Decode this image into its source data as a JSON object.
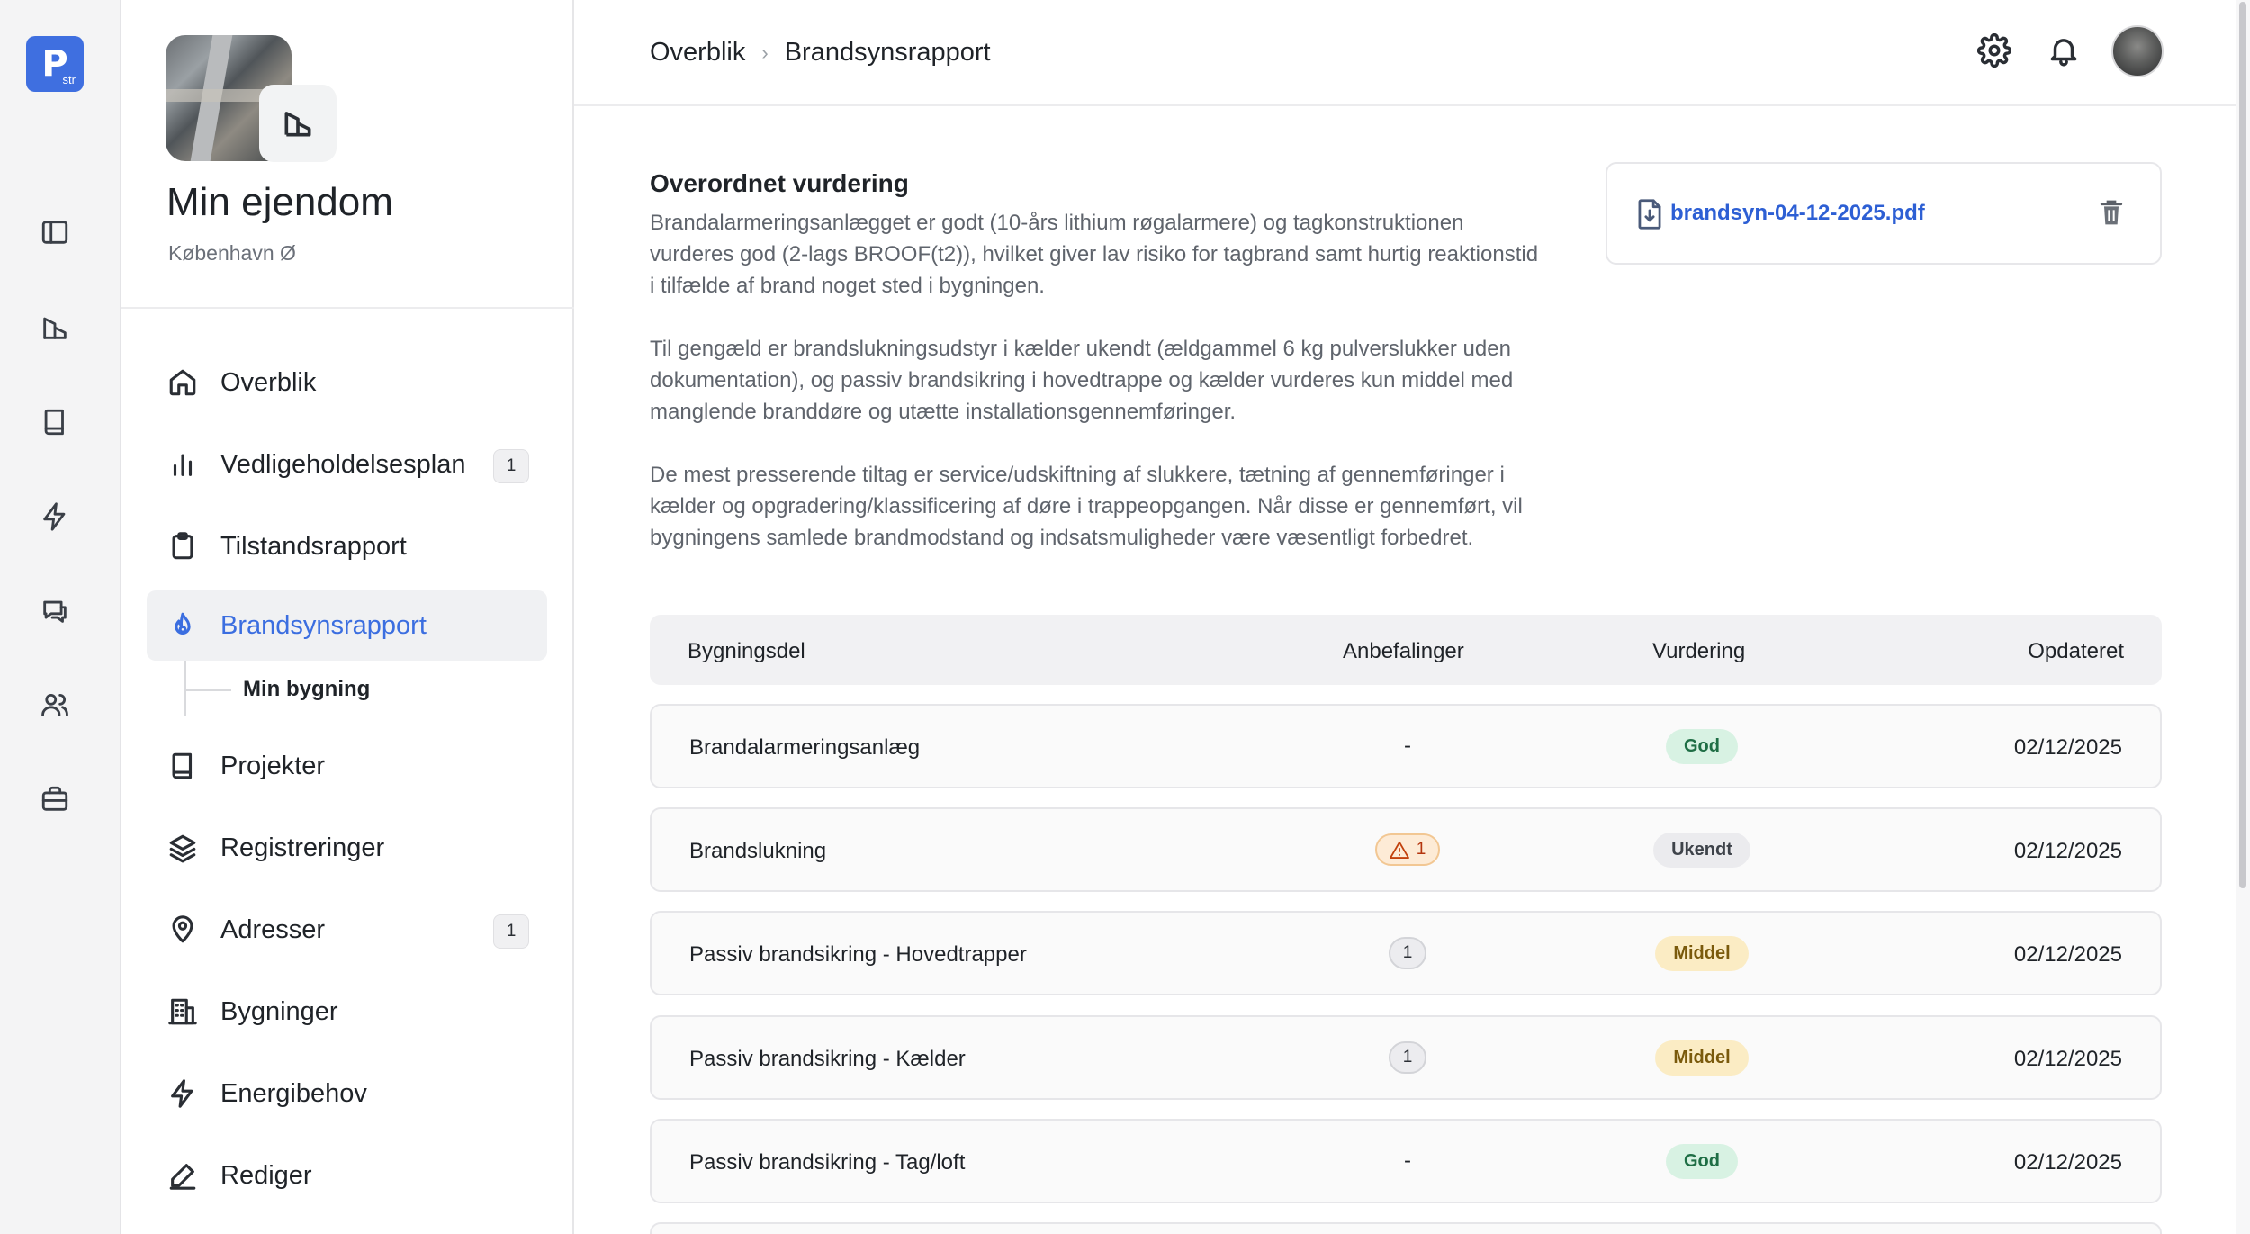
{
  "rail": {
    "logo_text": "P",
    "logo_sub": "str",
    "icons": [
      "sidebar-toggle-icon",
      "building-icon",
      "book-icon",
      "lightning-icon",
      "chat-icon",
      "users-icon",
      "briefcase-icon"
    ]
  },
  "property": {
    "title": "Min ejendom",
    "location": "København Ø"
  },
  "nav": {
    "items": [
      {
        "label": "Overblik",
        "icon": "home-icon"
      },
      {
        "label": "Vedligeholdelsesplan",
        "icon": "bar-chart-icon",
        "count": "1"
      },
      {
        "label": "Tilstandsrapport",
        "icon": "clipboard-icon"
      },
      {
        "label": "Brandsynsrapport",
        "icon": "flame-icon",
        "active": true
      },
      {
        "label": "Projekter",
        "icon": "book-icon"
      },
      {
        "label": "Registreringer",
        "icon": "layers-icon"
      },
      {
        "label": "Adresser",
        "icon": "map-pin-icon",
        "count": "1"
      },
      {
        "label": "Bygninger",
        "icon": "office-building-icon"
      },
      {
        "label": "Energibehov",
        "icon": "lightning-icon"
      },
      {
        "label": "Rediger",
        "icon": "pen-icon"
      }
    ],
    "sub_item": "Min bygning"
  },
  "breadcrumb": {
    "root": "Overblik",
    "separator": "›",
    "current": "Brandsynsrapport"
  },
  "assessment": {
    "title": "Overordnet vurdering",
    "paragraphs": [
      [
        "Brandalarmeringsanlægget er godt (10-års lithium røgalarmere) og tagkonstruktionen",
        "vurderes god (2-lags BROOF(t2)), hvilket giver lav risiko for tagbrand samt hurtig reaktionstid",
        "i tilfælde af brand noget sted i bygningen."
      ],
      [
        "Til gengæld er brandslukningsudstyr i kælder ukendt (ældgammel 6 kg pulverslukker uden",
        "dokumentation), og passiv brandsikring i hovedtrappe og kælder vurderes kun middel med",
        "manglende branddøre og utætte installationsgennemføringer."
      ],
      [
        "De mest presserende tiltag er service/udskiftning af slukkere, tætning af gennemføringer i",
        "kælder og opgradering/klassificering af døre i trappeopgangen. Når disse er gennemført, vil",
        "bygningens samlede brandmodstand og indsatsmuligheder være væsentligt forbedret."
      ]
    ]
  },
  "file": {
    "name": "brandsyn-04-12-2025.pdf"
  },
  "table": {
    "headers": [
      "Bygningsdel",
      "Anbefalinger",
      "Vurdering",
      "Opdateret"
    ],
    "rows": [
      {
        "part": "Brandalarmeringsanlæg",
        "recommendations": "-",
        "rec_type": "none",
        "rating": "God",
        "rating_type": "god",
        "updated": "02/12/2025"
      },
      {
        "part": "Brandslukning",
        "recommendations": "1",
        "rec_type": "warn",
        "rating": "Ukendt",
        "rating_type": "ukendt",
        "updated": "02/12/2025"
      },
      {
        "part": "Passiv brandsikring - Hovedtrapper",
        "recommendations": "1",
        "rec_type": "count",
        "rating": "Middel",
        "rating_type": "middel",
        "updated": "02/12/2025"
      },
      {
        "part": "Passiv brandsikring - Kælder",
        "recommendations": "1",
        "rec_type": "count",
        "rating": "Middel",
        "rating_type": "middel",
        "updated": "02/12/2025"
      },
      {
        "part": "Passiv brandsikring - Tag/loft",
        "recommendations": "-",
        "rec_type": "none",
        "rating": "God",
        "rating_type": "god",
        "updated": "02/12/2025"
      }
    ]
  },
  "colors": {
    "accent": "#3b6ee0",
    "logo": "#3f6fe0",
    "god": "#d8f2e3",
    "middel": "#fbecc4",
    "ukendt": "#ebebee",
    "warn": "#b4350e"
  }
}
